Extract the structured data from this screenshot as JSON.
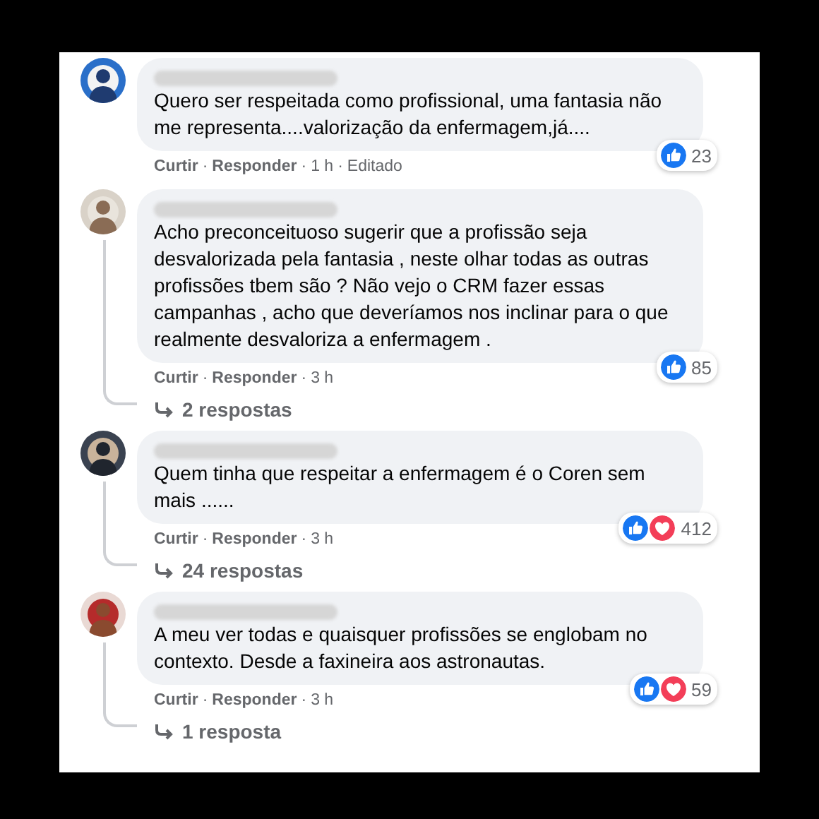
{
  "separator": "·",
  "comments": [
    {
      "name_redacted": true,
      "text": "Quero ser respeitada como profissional, uma fantasia não me representa....valorização da enfermagem,já....",
      "actions": [
        "Curtir",
        "Responder",
        "1 h",
        "Editado"
      ],
      "reactions": [
        {
          "kind": "like"
        }
      ],
      "reaction_count": "23"
    },
    {
      "name_redacted": true,
      "text": "Acho preconceituoso sugerir que a profissão seja desvalorizada pela fantasia , neste olhar todas as outras profissões tbem são ? Não vejo o CRM fazer essas campanhas , acho que deveríamos nos inclinar para o que realmente desvaloriza a enfermagem .",
      "actions": [
        "Curtir",
        "Responder",
        "3 h"
      ],
      "reactions": [
        {
          "kind": "like"
        }
      ],
      "reaction_count": "85",
      "replies_link": "2 respostas"
    },
    {
      "name_redacted": true,
      "text": "Quem tinha que respeitar a enfermagem é o Coren sem mais ......",
      "actions": [
        "Curtir",
        "Responder",
        "3 h"
      ],
      "reactions": [
        {
          "kind": "like"
        },
        {
          "kind": "love"
        }
      ],
      "reaction_count": "412",
      "replies_link": "24 respostas"
    },
    {
      "name_redacted": true,
      "text": "A meu ver todas e quaisquer profissões se englobam no contexto. Desde a faxineira aos astronautas.",
      "actions": [
        "Curtir",
        "Responder",
        "3 h"
      ],
      "reactions": [
        {
          "kind": "like"
        },
        {
          "kind": "love"
        }
      ],
      "reaction_count": "59",
      "replies_link": "1 resposta"
    }
  ]
}
